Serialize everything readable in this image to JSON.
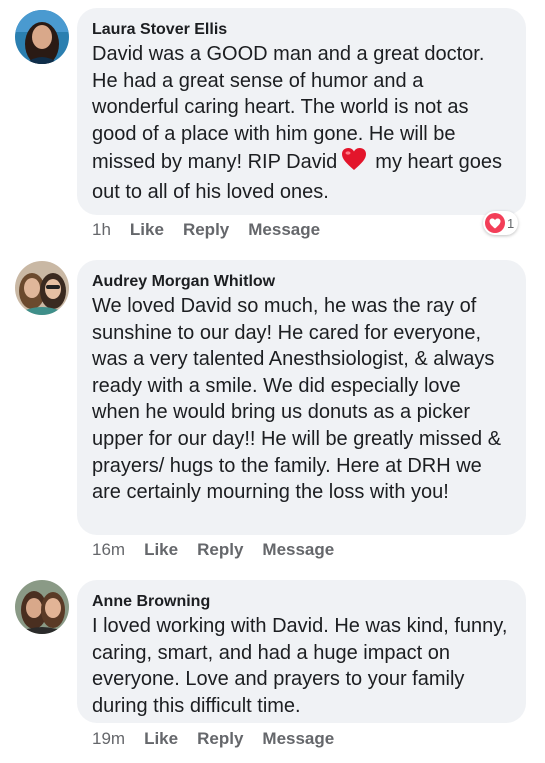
{
  "comments": [
    {
      "author": "Laura Stover Ellis",
      "text_before_emoji": "David was a GOOD man and a great doctor. He had a great sense of humor and a wonderful caring heart.  The world is not as good of a place with him gone.  He will be missed by many!  RIP David",
      "text_after_emoji": "my heart goes out to all of his loved ones.",
      "emoji": "red-heart-icon",
      "time": "1h",
      "like_label": "Like",
      "reply_label": "Reply",
      "message_label": "Message",
      "reaction_count": "1",
      "reaction_icon": "love-reaction-icon"
    },
    {
      "author": "Audrey Morgan Whitlow",
      "text": "We loved David so much, he was the ray of sunshine to our day! He cared for everyone, was a very talented Anesthsiologist, & always ready with a smile. We did especially love when he would bring us donuts as a picker upper for our day!! He will be greatly missed & prayers/ hugs to the family. Here at DRH we are certainly mourning the loss with you!",
      "time": "16m",
      "like_label": "Like",
      "reply_label": "Reply",
      "message_label": "Message"
    },
    {
      "author": "Anne Browning",
      "text": "I loved working with David. He was kind, funny, caring, smart, and had a huge impact on everyone. Love and prayers to your family during this difficult time.",
      "time": "19m",
      "like_label": "Like",
      "reply_label": "Reply",
      "message_label": "Message"
    }
  ],
  "colors": {
    "bubble": "#f0f2f5",
    "meta_text": "#65676b",
    "love_reaction": "#f33e58"
  }
}
